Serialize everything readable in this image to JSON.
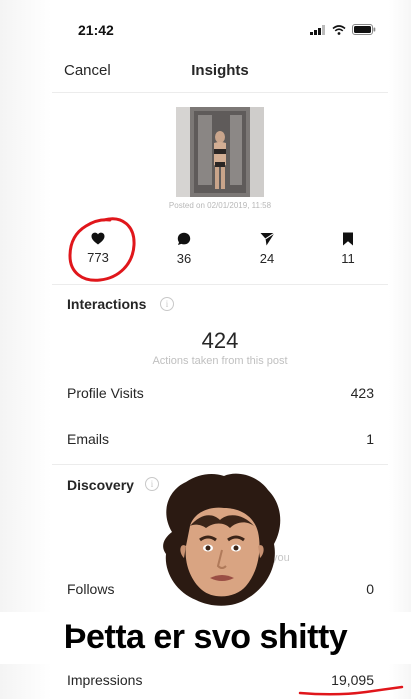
{
  "status_bar": {
    "time": "21:42"
  },
  "nav": {
    "cancel_label": "Cancel",
    "title": "Insights"
  },
  "post": {
    "posted_on": "Posted on 02/01/2019, 11:58"
  },
  "stats": [
    {
      "icon": "heart-icon",
      "count": "773"
    },
    {
      "icon": "comment-icon",
      "count": "36"
    },
    {
      "icon": "send-icon",
      "count": "24"
    },
    {
      "icon": "bookmark-icon",
      "count": "11"
    }
  ],
  "interactions": {
    "title": "Interactions",
    "total": "424",
    "caption": "Actions taken from this post",
    "rows": [
      {
        "label": "Profile Visits",
        "value": "423"
      },
      {
        "label": "Emails",
        "value": "1"
      }
    ]
  },
  "discovery": {
    "title": "Discovery",
    "faded_text": "you",
    "rows": [
      {
        "label": "Follows",
        "value": "0"
      },
      {
        "label": "Impressions",
        "value": "19,095"
      }
    ]
  },
  "overlay": {
    "caption": "Þetta er svo shitty"
  },
  "colors": {
    "annotation_red": "#e0161b",
    "text": "#262626",
    "muted": "#c0c0c0"
  }
}
